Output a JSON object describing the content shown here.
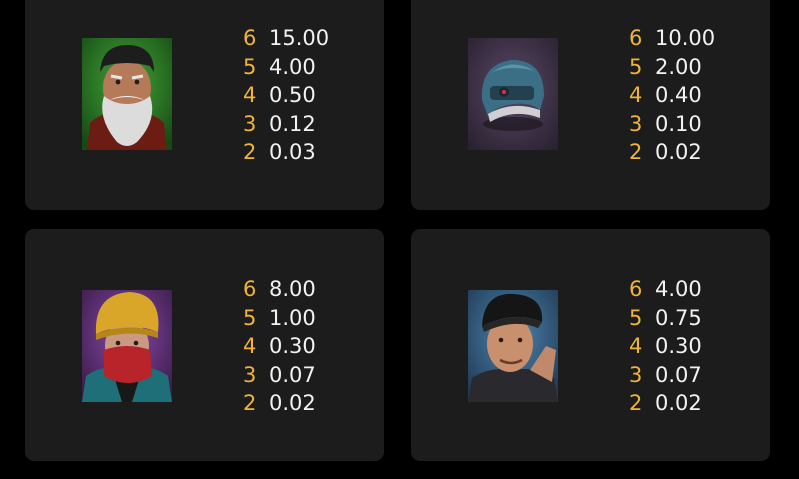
{
  "colors": {
    "background": "#000000",
    "card": "#1c1c1c",
    "count": "#f0b43a",
    "payout": "#f2f2f2"
  },
  "symbols": [
    {
      "icon": "bearded-old-man-portrait-icon",
      "rows": [
        {
          "count": "6",
          "payout": "15.00"
        },
        {
          "count": "5",
          "payout": "4.00"
        },
        {
          "count": "4",
          "payout": "0.50"
        },
        {
          "count": "3",
          "payout": "0.12"
        },
        {
          "count": "2",
          "payout": "0.03"
        }
      ]
    },
    {
      "icon": "combat-helmet-icon",
      "rows": [
        {
          "count": "6",
          "payout": "10.00"
        },
        {
          "count": "5",
          "payout": "2.00"
        },
        {
          "count": "4",
          "payout": "0.40"
        },
        {
          "count": "3",
          "payout": "0.10"
        },
        {
          "count": "2",
          "payout": "0.02"
        }
      ]
    },
    {
      "icon": "masked-woman-yellow-beanie-icon",
      "rows": [
        {
          "count": "6",
          "payout": "8.00"
        },
        {
          "count": "5",
          "payout": "1.00"
        },
        {
          "count": "4",
          "payout": "0.30"
        },
        {
          "count": "3",
          "payout": "0.07"
        },
        {
          "count": "2",
          "payout": "0.02"
        }
      ]
    },
    {
      "icon": "man-black-cap-saluting-icon",
      "rows": [
        {
          "count": "6",
          "payout": "4.00"
        },
        {
          "count": "5",
          "payout": "0.75"
        },
        {
          "count": "4",
          "payout": "0.30"
        },
        {
          "count": "3",
          "payout": "0.07"
        },
        {
          "count": "2",
          "payout": "0.02"
        }
      ]
    }
  ]
}
